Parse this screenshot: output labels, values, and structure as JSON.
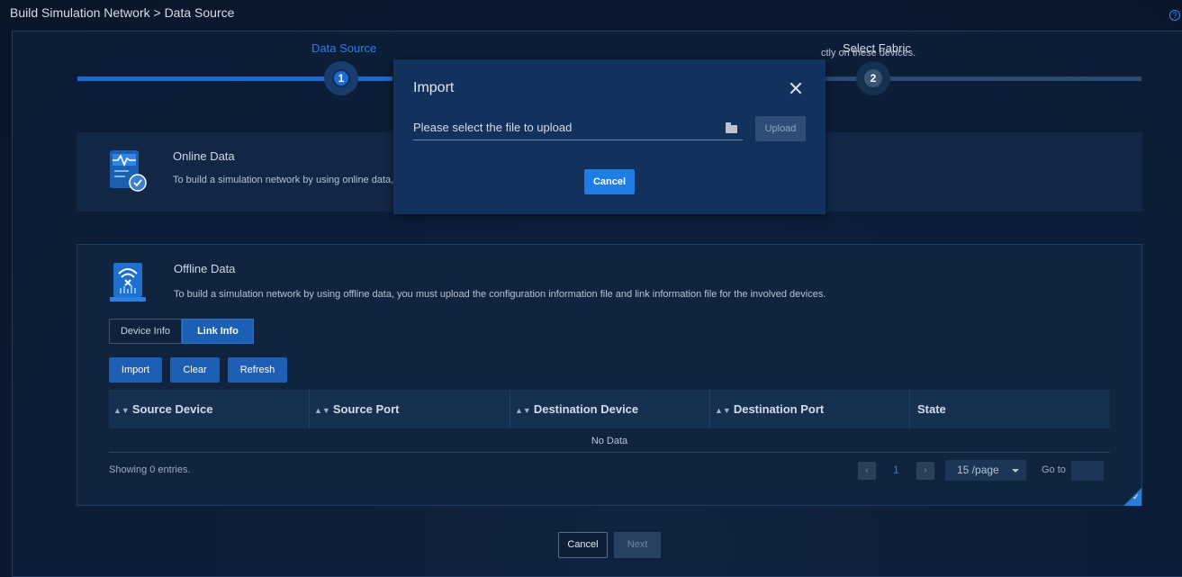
{
  "breadcrumb": "Build Simulation Network > Data Source",
  "help_icon": "?",
  "steps": [
    {
      "title": "Data Source",
      "number": "1"
    },
    {
      "title": "Select Fabric",
      "number": "2"
    }
  ],
  "online": {
    "title": "Online Data",
    "desc_left": "To build a simulation network by using online data, u",
    "desc_right": "ctly on these devices."
  },
  "offline": {
    "title": "Offline Data",
    "desc": "To build a simulation network by using offline data, you must upload the configuration information file and link information file for the involved devices."
  },
  "tabs": {
    "device": "Device Info",
    "link": "Link Info"
  },
  "actions": {
    "import": "Import",
    "clear": "Clear",
    "refresh": "Refresh"
  },
  "table": {
    "columns": [
      "Source Device",
      "Source Port",
      "Destination Device",
      "Destination Port",
      "State"
    ],
    "empty": "No Data"
  },
  "pagination": {
    "showing": "Showing 0 entries.",
    "prev": "‹",
    "next": "›",
    "page": "1",
    "page_size": "15 /page",
    "goto": "Go to"
  },
  "footer": {
    "cancel": "Cancel",
    "next": "Next"
  },
  "modal": {
    "title": "Import",
    "placeholder": "Please select the file to upload",
    "upload": "Upload",
    "cancel": "Cancel"
  },
  "corner_tick": "✓"
}
